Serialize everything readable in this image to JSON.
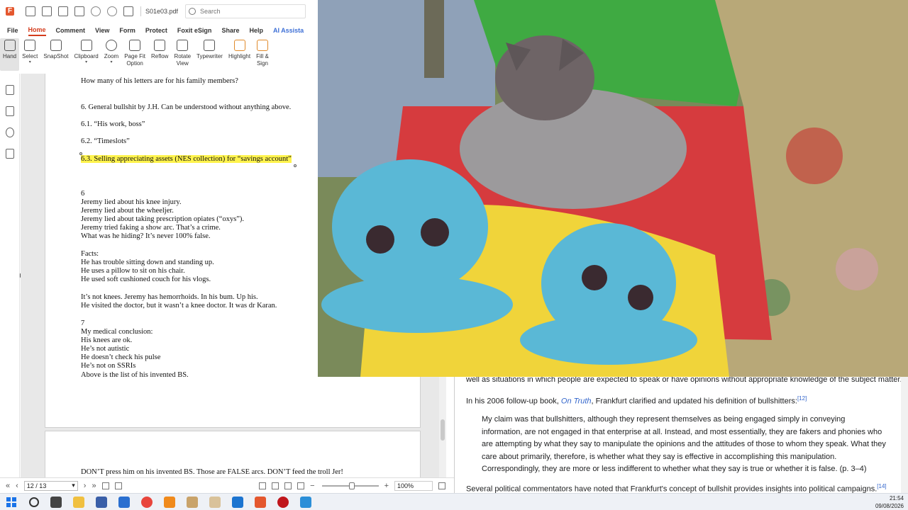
{
  "pdf": {
    "doc_name": "S01e03.pdf",
    "search_placeholder": "Search",
    "menu": [
      "File",
      "Home",
      "Comment",
      "View",
      "Form",
      "Protect",
      "Foxit eSign",
      "Share",
      "Help",
      "AI Assista"
    ],
    "ribbon": [
      {
        "label": "Hand",
        "caret": false
      },
      {
        "label": "Select",
        "caret": true
      },
      {
        "label": "SnapShot",
        "caret": false
      },
      {
        "label": "Clipboard",
        "caret": true
      },
      {
        "label": "Zoom",
        "caret": true
      },
      {
        "label": "Page Fit\nOption",
        "caret": true
      },
      {
        "label": "Reflow",
        "caret": false
      },
      {
        "label": "Rotate\nView",
        "caret": true
      },
      {
        "label": "Typewriter",
        "caret": false
      },
      {
        "label": "Highlight",
        "caret": false
      },
      {
        "label": "Fill &\nSign",
        "caret": false
      }
    ],
    "page_lines": [
      "How many of his letters are for his family members?",
      "6. General bullshit by J.H. Can be understood without anything above.",
      "6.1. “His work, boss”",
      "6.2. “Timeslots”",
      "6.3. Selling appreciating assets (NES collection) for “savings account”",
      "6",
      "Jeremy lied about his knee injury.",
      "Jeremy lied about the wheeljer.",
      "Jeremy lied about taking prescription opiates (“oxys”).",
      "Jeremy tried faking a show arc. That’s a crime.",
      "What was he hiding? It’s never 100% false.",
      "Facts:",
      "He has trouble sitting down and standing up.",
      "He uses a pillow to sit on his chair.",
      "He used soft cushioned couch for his vlogs.",
      "It’s not knees. Jeremy has hemorrhoids. In his bum. Up his.",
      "He visited the doctor, but it wasn’t a knee doctor. It was dr Karan.",
      "7",
      "My medical conclusion:",
      "His knees are ok.",
      "He’s not autistic",
      "He doesn’t check his pulse",
      "He’s not on SSRIs",
      "Above is the list of his invented BS."
    ],
    "page2_line": "DON’T press him on his invented BS. Those are FALSE arcs. DON’T feed the troll Jer!",
    "page_indicator": "12 / 13",
    "zoom": "100%",
    "highlight_color": "#fff34d",
    "accent_color": "#d43c1d"
  },
  "wiki": {
    "line1": "well as situations in which people are expected to speak or have opinions without appropriate knowledge of the subject matter.",
    "line2_pre": "In his 2006 follow-up book, ",
    "line2_link": "On Truth",
    "line2_post": ", Frankfurt clarified and updated his definition of bullshitters:",
    "line2_ref": "[12]",
    "quote": "My claim was that bullshitters, although they represent themselves as being engaged simply in conveying information, are not engaged in that enterprise at all. Instead, and most essentially, they are fakers and phonies who are attempting by what they say to manipulate the opinions and the attitudes of those to whom they speak. What they care about primarily, therefore, is whether what they say is effective in accomplishing this manipulation. Correspondingly, they are more or less indifferent to whether what they say is true or whether it is false. (p. 3–4)",
    "line3": "Several political commentators have noted that Frankfurt's concept of bullshit provides insights into political campaigns.",
    "line3_ref": "[14]"
  },
  "taskbar": {
    "time": "21:54",
    "date": "09/08/2026",
    "apps": [
      "file-explorer",
      "app-2",
      "app-3",
      "chrome",
      "vlc",
      "app-6",
      "app-7",
      "app-8",
      "foxit",
      "app-10",
      "app-11"
    ]
  }
}
